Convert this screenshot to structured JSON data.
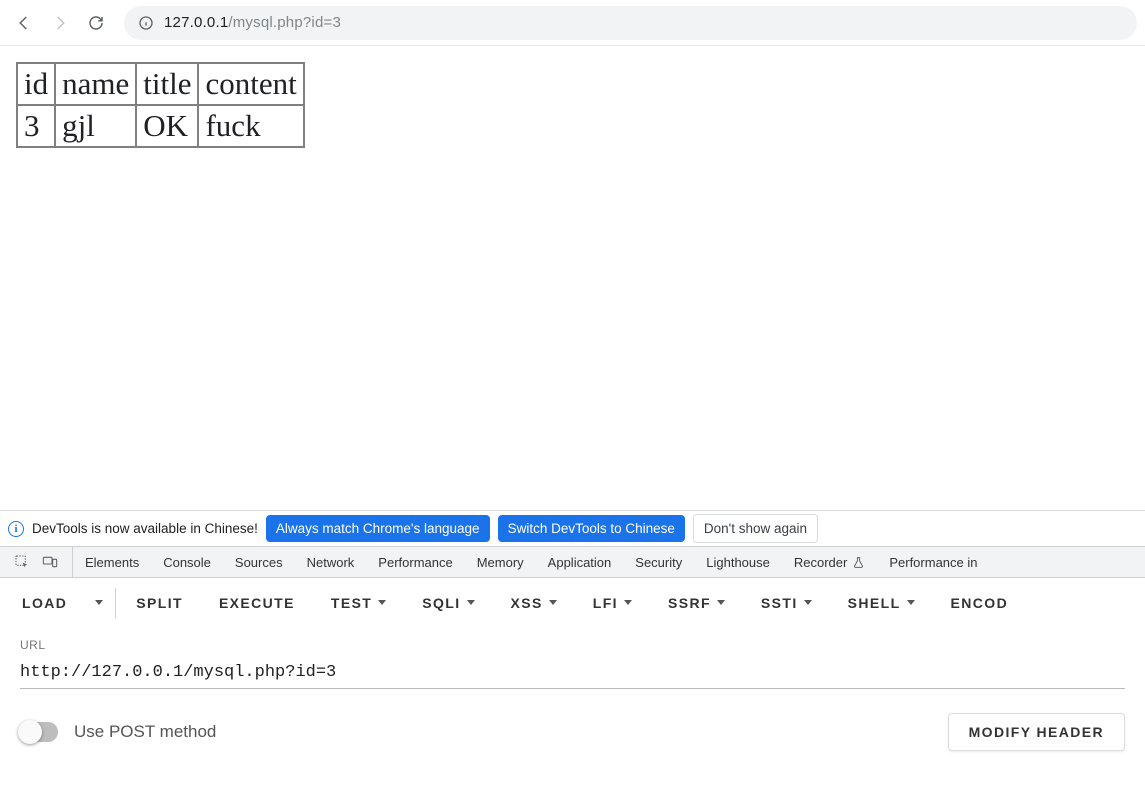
{
  "browser": {
    "url_display_prefix": "127.0.0.1",
    "url_display_suffix": "/mysql.php?id=3"
  },
  "page": {
    "table": {
      "headers": [
        "id",
        "name",
        "title",
        "content"
      ],
      "row": [
        "3",
        "gjl",
        "OK",
        "fuck"
      ]
    }
  },
  "infobar": {
    "message": "DevTools is now available in Chinese!",
    "btn_always": "Always match Chrome's language",
    "btn_switch": "Switch DevTools to Chinese",
    "btn_dismiss": "Don't show again"
  },
  "devtools_tabs": {
    "elements": "Elements",
    "console": "Console",
    "sources": "Sources",
    "network": "Network",
    "performance": "Performance",
    "memory": "Memory",
    "application": "Application",
    "security": "Security",
    "lighthouse": "Lighthouse",
    "recorder": "Recorder",
    "performance_insights": "Performance in"
  },
  "hackbar": {
    "load": "LOAD",
    "split": "SPLIT",
    "execute": "EXECUTE",
    "test": "TEST",
    "sqli": "SQLI",
    "xss": "XSS",
    "lfi": "LFI",
    "ssrf": "SSRF",
    "ssti": "SSTI",
    "shell": "SHELL",
    "encod": "ENCOD",
    "url_label": "URL",
    "url_value": "http://127.0.0.1/mysql.php?id=3",
    "use_post": "Use POST method",
    "modify_header": "MODIFY HEADER"
  }
}
